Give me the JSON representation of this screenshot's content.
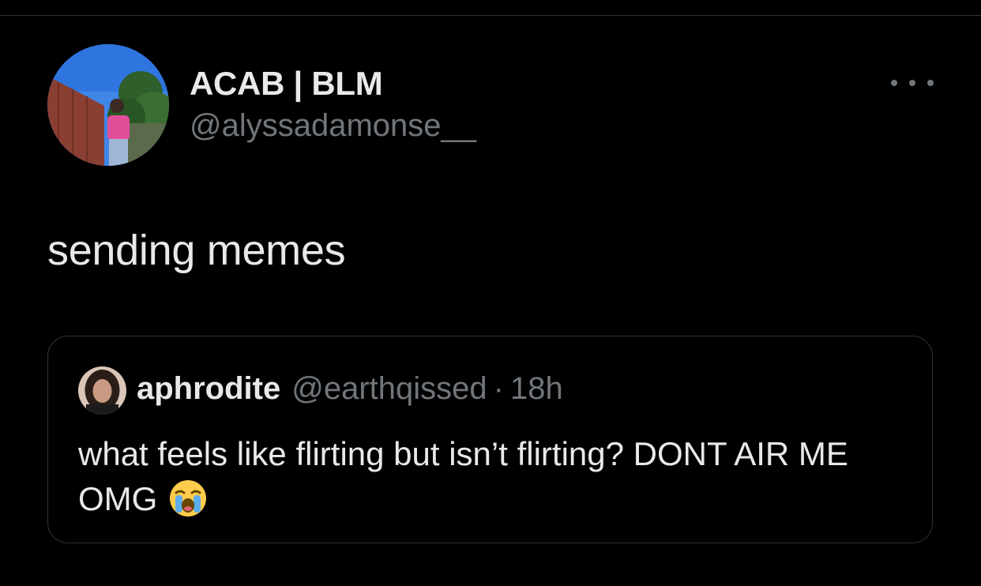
{
  "tweet": {
    "author": {
      "display_name": "ACAB | BLM",
      "handle": "@alyssadamonse__"
    },
    "more_icon": "more-horizontal-icon",
    "text": "sending memes",
    "quoted": {
      "author": {
        "display_name": "aphrodite",
        "handle": "@earthqissed"
      },
      "separator": "·",
      "time": "18h",
      "text": "what feels like flirting but isn’t flirting?  DONT AIR ME OMG",
      "emoji": "loudly-crying-face-emoji"
    }
  },
  "colors": {
    "background": "#000000",
    "primary_text": "#e7e9ea",
    "secondary_text": "#71767b",
    "border": "#2f3336"
  }
}
